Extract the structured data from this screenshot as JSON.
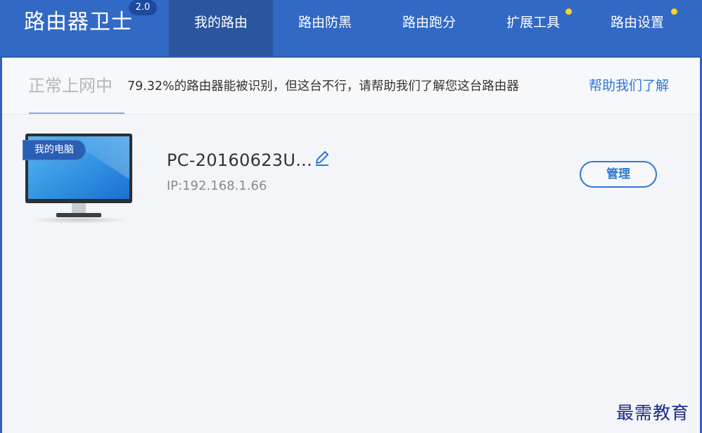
{
  "app": {
    "title": "路由器卫士",
    "version": "2.0"
  },
  "nav": {
    "items": [
      {
        "label": "我的路由",
        "active": true,
        "has_dot": false
      },
      {
        "label": "路由防黑",
        "active": false,
        "has_dot": false
      },
      {
        "label": "路由跑分",
        "active": false,
        "has_dot": false
      },
      {
        "label": "扩展工具",
        "active": false,
        "has_dot": true
      },
      {
        "label": "路由设置",
        "active": false,
        "has_dot": true
      }
    ]
  },
  "status": {
    "main": "正常上网中",
    "message": "79.32%的路由器能被识别，但这台不行，请帮助我们了解您这台路由器",
    "link": "帮助我们了解"
  },
  "device": {
    "badge": "我的电脑",
    "name": "PC-20160623U...",
    "ip": "IP:192.168.1.66",
    "manage_label": "管理"
  },
  "watermark": "最需教育",
  "colors": {
    "header": "#3169c5",
    "active_tab": "#2a56a0",
    "accent": "#2f78d6",
    "dot": "#ffd21f"
  }
}
